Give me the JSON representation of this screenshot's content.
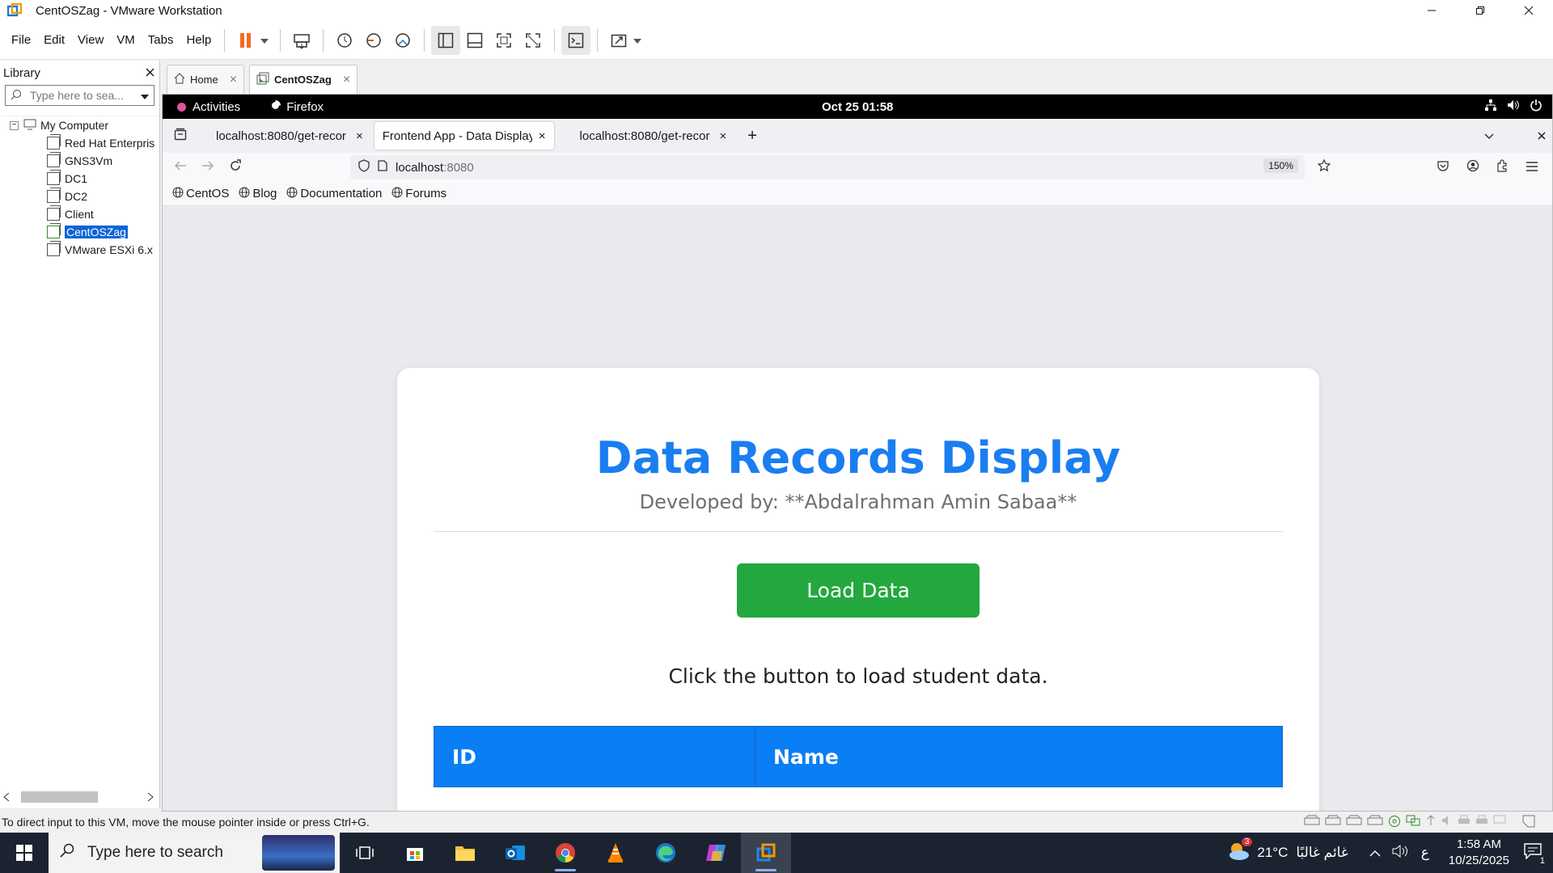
{
  "window": {
    "title": "CentOSZag - VMware Workstation"
  },
  "menu": [
    "File",
    "Edit",
    "View",
    "VM",
    "Tabs",
    "Help"
  ],
  "library": {
    "title": "Library",
    "search_placeholder": "Type here to sea...",
    "root": "My Computer",
    "vms": [
      "Red Hat Enterpris",
      "GNS3Vm",
      "DC1",
      "DC2",
      "Client",
      "CentOSZag",
      "VMware ESXi 6.x"
    ],
    "selected": "CentOSZag"
  },
  "vm_tabs": [
    {
      "label": "Home",
      "active": false
    },
    {
      "label": "CentOSZag",
      "active": true
    }
  ],
  "gnome": {
    "activities": "Activities",
    "app": "Firefox",
    "clock": "Oct 25  01:58"
  },
  "firefox": {
    "tabs": [
      {
        "label": "localhost:8080/get-recor"
      },
      {
        "label": "Frontend App - Data Display"
      },
      {
        "label": "localhost:8080/get-recor"
      }
    ],
    "url_host": "localhost",
    "url_port": ":8080",
    "zoom": "150%",
    "bookmarks": [
      "CentOS",
      "Blog",
      "Documentation",
      "Forums"
    ]
  },
  "app_page": {
    "heading": "Data Records Display",
    "subtitle": "Developed by: **Abdalrahman Amin Sabaa**",
    "button": "Load Data",
    "message": "Click the button to load student data.",
    "table_headers": [
      "ID",
      "Name"
    ]
  },
  "status_line": "To direct input to this VM, move the mouse pointer inside or press Ctrl+G.",
  "taskbar": {
    "search_placeholder": "Type here to search",
    "weather_temp": "21°C",
    "weather_text": "غائم غالبًا",
    "weather_badge": "3",
    "ime": "ع",
    "time": "1:58 AM",
    "date": "10/25/2025",
    "notifications": "1"
  },
  "colors": {
    "heading_blue": "#1a7ef0",
    "button_green": "#23a83f",
    "table_header_blue": "#0a7ef5",
    "vmware_orange": "#f26b21"
  }
}
